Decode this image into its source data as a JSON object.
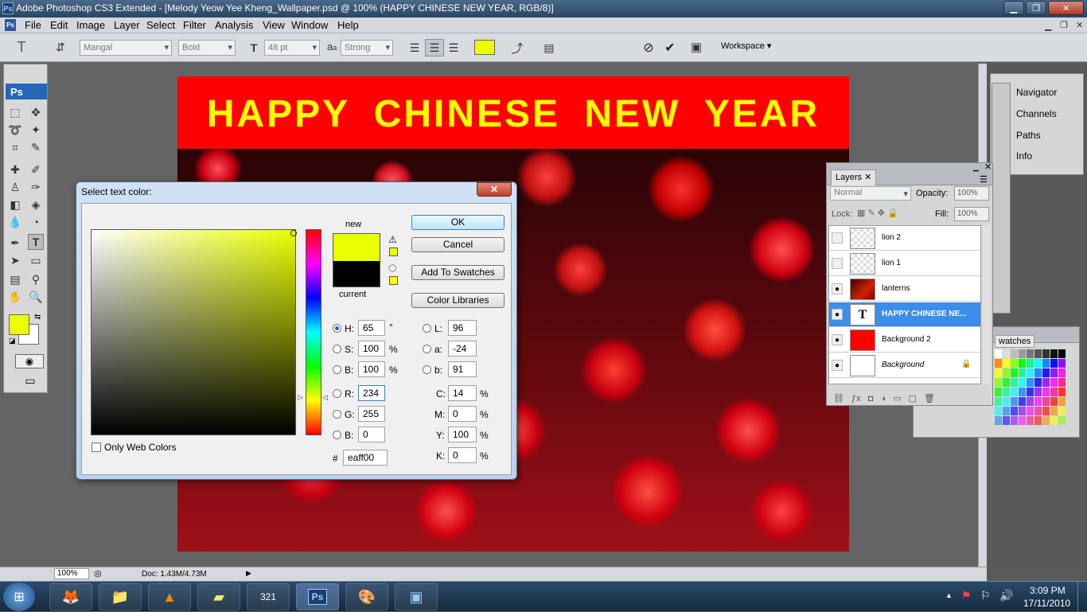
{
  "window": {
    "title": "Adobe Photoshop CS3 Extended - [Melody Yeow Yee Kheng_Wallpaper.psd @ 100% (HAPPY CHINESE NEW YEAR, RGB/8)]",
    "app_icon": "Ps"
  },
  "menu": [
    "File",
    "Edit",
    "Image",
    "Layer",
    "Select",
    "Filter",
    "Analysis",
    "View",
    "Window",
    "Help"
  ],
  "options": {
    "font_family": "Mangal",
    "font_style": "Bold",
    "font_size": "48 pt",
    "aa_label": "a",
    "aa_sub": "a",
    "antialias": "Strong",
    "text_color": "#eaff00",
    "workspace": "Workspace"
  },
  "canvas": {
    "headline": "HAPPY CHINESE NEW YEAR"
  },
  "tools": {
    "logo": "Ps"
  },
  "status": {
    "zoom": "100%",
    "doc": "Doc: 1.43M/4.73M"
  },
  "dialog": {
    "title": "Select text color:",
    "new_label": "new",
    "current_label": "current",
    "new_color": "#eaff00",
    "current_color": "#000000",
    "ok": "OK",
    "cancel": "Cancel",
    "add_swatches": "Add To Swatches",
    "color_libraries": "Color Libraries",
    "only_web": "Only Web Colors",
    "hsb": {
      "h_label": "H:",
      "h": "65",
      "h_unit": "°",
      "s_label": "S:",
      "s": "100",
      "s_unit": "%",
      "b_label": "B:",
      "b": "100",
      "b_unit": "%"
    },
    "rgb": {
      "r_label": "R:",
      "r": "234",
      "g_label": "G:",
      "g": "255",
      "b_label": "B:",
      "b": "0"
    },
    "lab": {
      "l_label": "L:",
      "l": "96",
      "a_label": "a:",
      "a": "-24",
      "b_label": "b:",
      "b": "91"
    },
    "cmyk": {
      "c_label": "C:",
      "c": "14",
      "m_label": "M:",
      "m": "0",
      "y_label": "Y:",
      "y": "100",
      "k_label": "K:",
      "k": "0",
      "unit": "%"
    },
    "hex_label": "#",
    "hex": "eaff00"
  },
  "panels": {
    "dock": [
      "Navigator",
      "Channels",
      "Paths",
      "Info"
    ],
    "layers_tab": "Layers",
    "blend": "Normal",
    "opacity_label": "Opacity:",
    "opacity": "100%",
    "lock_label": "Lock:",
    "fill_label": "Fill:",
    "fill": "100%",
    "layers": [
      {
        "name": "lion 2",
        "visible": false
      },
      {
        "name": "lion 1",
        "visible": false
      },
      {
        "name": "lanterns",
        "visible": true
      },
      {
        "name": "HAPPY CHINESE NE...",
        "visible": true,
        "selected": true,
        "thumb": "T"
      },
      {
        "name": "Background 2",
        "visible": true
      },
      {
        "name": "Background",
        "visible": true,
        "locked": true
      }
    ],
    "swatches_tab": "watches"
  },
  "taskbar": {
    "time": "3:09 PM",
    "date": "17/11/2010",
    "ps_label": "Ps"
  }
}
